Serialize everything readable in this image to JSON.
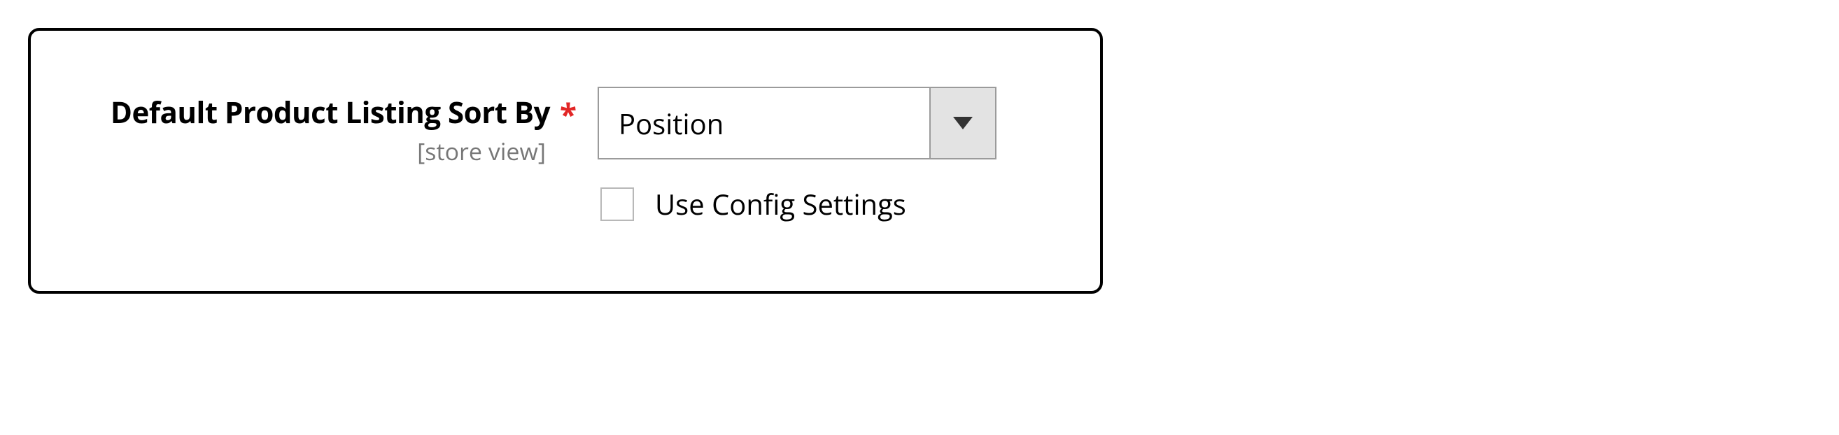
{
  "field": {
    "label": "Default Product Listing Sort By",
    "required_marker": "*",
    "scope": "[store view]",
    "select_value": "Position",
    "checkbox_label": "Use Config Settings"
  }
}
